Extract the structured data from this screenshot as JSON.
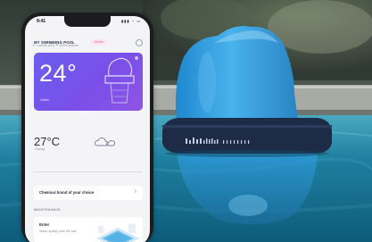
{
  "phone": {
    "status_time": "9:41",
    "status_icons": "▮▮▮ ◔ ▭"
  },
  "app": {
    "pool_name": "MY SWIMMING POOL",
    "pool_tag": "Active",
    "water_temperature": "24°",
    "water_label": "Water",
    "air_temperature": "27°C",
    "weather_condition": "Cloudy",
    "weather_stats": "☀ 1 sunny (UV)        ☂ 100% chance",
    "chemical_prompt": "Chemical brand of your choice",
    "section_title": "MAINTENANCE",
    "tip_title": "Enter",
    "tip_body": "Water quality over the last"
  },
  "colors": {
    "accent": "#6b5ef0",
    "float_blue": "#3aa3e0",
    "pool_water": "#1f7f9e"
  },
  "icons": [
    "wifi-icon",
    "battery-icon",
    "cloud-icon",
    "chevron-right-icon",
    "menu-icon"
  ]
}
